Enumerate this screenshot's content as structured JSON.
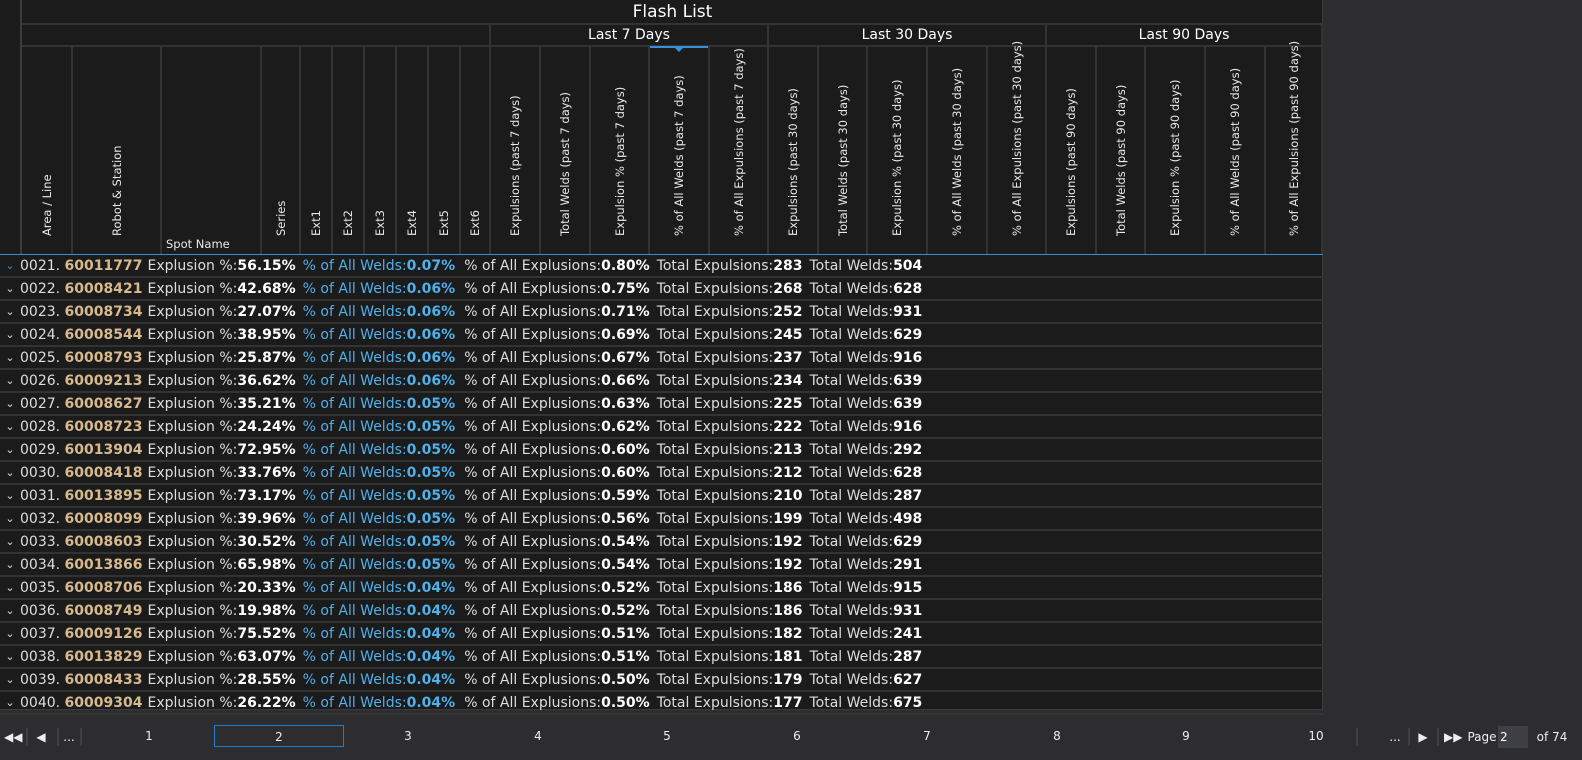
{
  "title": "Flash List",
  "groups": [
    "Last 7 Days",
    "Last 30 Days",
    "Last 90 Days"
  ],
  "columns": [
    "Area / Line",
    "Robot & Station",
    "Spot Name",
    "Series",
    "Ext1",
    "Ext2",
    "Ext3",
    "Ext4",
    "Ext5",
    "Ext6",
    "Expulsions (past 7 days)",
    "Total Welds (past 7 days)",
    "Expulsion % (past 7 days)",
    "% of All Welds (past 7 days)",
    "% of All Expulsions (past 7 days)",
    "Expulsions (past 30 days)",
    "Total Welds (past 30 days)",
    "Expulsion % (past 30 days)",
    "% of All Welds (past 30 days)",
    "% of All Expulsions (past 30 days)",
    "Expulsions (past 90 days)",
    "Total Welds (past 90 days)",
    "Expulsion % (past 90 days)",
    "% of All Welds (past 90 days)",
    "% of All Expulsions (past 90 days)"
  ],
  "labels": {
    "exp_pct": "Explusion %:",
    "pct_welds": "% of All Welds:",
    "pct_exp": "% of All Explusions:",
    "total_exp": "Total Expulsions:",
    "total_welds": "Total Welds:"
  },
  "rows": [
    {
      "n": "0021.",
      "id": "60011777",
      "exp": "56.15%",
      "welds_pct": "0.07%",
      "exps_pct": "0.80%",
      "total_exp": "283",
      "total_welds": "504"
    },
    {
      "n": "0022.",
      "id": "60008421",
      "exp": "42.68%",
      "welds_pct": "0.06%",
      "exps_pct": "0.75%",
      "total_exp": "268",
      "total_welds": "628"
    },
    {
      "n": "0023.",
      "id": "60008734",
      "exp": "27.07%",
      "welds_pct": "0.06%",
      "exps_pct": "0.71%",
      "total_exp": "252",
      "total_welds": "931"
    },
    {
      "n": "0024.",
      "id": "60008544",
      "exp": "38.95%",
      "welds_pct": "0.06%",
      "exps_pct": "0.69%",
      "total_exp": "245",
      "total_welds": "629"
    },
    {
      "n": "0025.",
      "id": "60008793",
      "exp": "25.87%",
      "welds_pct": "0.06%",
      "exps_pct": "0.67%",
      "total_exp": "237",
      "total_welds": "916"
    },
    {
      "n": "0026.",
      "id": "60009213",
      "exp": "36.62%",
      "welds_pct": "0.06%",
      "exps_pct": "0.66%",
      "total_exp": "234",
      "total_welds": "639"
    },
    {
      "n": "0027.",
      "id": "60008627",
      "exp": "35.21%",
      "welds_pct": "0.05%",
      "exps_pct": "0.63%",
      "total_exp": "225",
      "total_welds": "639"
    },
    {
      "n": "0028.",
      "id": "60008723",
      "exp": "24.24%",
      "welds_pct": "0.05%",
      "exps_pct": "0.62%",
      "total_exp": "222",
      "total_welds": "916"
    },
    {
      "n": "0029.",
      "id": "60013904",
      "exp": "72.95%",
      "welds_pct": "0.05%",
      "exps_pct": "0.60%",
      "total_exp": "213",
      "total_welds": "292"
    },
    {
      "n": "0030.",
      "id": "60008418",
      "exp": "33.76%",
      "welds_pct": "0.05%",
      "exps_pct": "0.60%",
      "total_exp": "212",
      "total_welds": "628"
    },
    {
      "n": "0031.",
      "id": "60013895",
      "exp": "73.17%",
      "welds_pct": "0.05%",
      "exps_pct": "0.59%",
      "total_exp": "210",
      "total_welds": "287"
    },
    {
      "n": "0032.",
      "id": "60008099",
      "exp": "39.96%",
      "welds_pct": "0.05%",
      "exps_pct": "0.56%",
      "total_exp": "199",
      "total_welds": "498"
    },
    {
      "n": "0033.",
      "id": "60008603",
      "exp": "30.52%",
      "welds_pct": "0.05%",
      "exps_pct": "0.54%",
      "total_exp": "192",
      "total_welds": "629"
    },
    {
      "n": "0034.",
      "id": "60013866",
      "exp": "65.98%",
      "welds_pct": "0.05%",
      "exps_pct": "0.54%",
      "total_exp": "192",
      "total_welds": "291"
    },
    {
      "n": "0035.",
      "id": "60008706",
      "exp": "20.33%",
      "welds_pct": "0.04%",
      "exps_pct": "0.52%",
      "total_exp": "186",
      "total_welds": "915"
    },
    {
      "n": "0036.",
      "id": "60008749",
      "exp": "19.98%",
      "welds_pct": "0.04%",
      "exps_pct": "0.52%",
      "total_exp": "186",
      "total_welds": "931"
    },
    {
      "n": "0037.",
      "id": "60009126",
      "exp": "75.52%",
      "welds_pct": "0.04%",
      "exps_pct": "0.51%",
      "total_exp": "182",
      "total_welds": "241"
    },
    {
      "n": "0038.",
      "id": "60013829",
      "exp": "63.07%",
      "welds_pct": "0.04%",
      "exps_pct": "0.51%",
      "total_exp": "181",
      "total_welds": "287"
    },
    {
      "n": "0039.",
      "id": "60008433",
      "exp": "28.55%",
      "welds_pct": "0.04%",
      "exps_pct": "0.50%",
      "total_exp": "179",
      "total_welds": "627"
    },
    {
      "n": "0040.",
      "id": "60009304",
      "exp": "26.22%",
      "welds_pct": "0.04%",
      "exps_pct": "0.50%",
      "total_exp": "177",
      "total_welds": "675"
    }
  ],
  "pager": {
    "ellipsis": "...",
    "pages": [
      "1",
      "2",
      "3",
      "4",
      "5",
      "6",
      "7",
      "8",
      "9",
      "10"
    ],
    "current": "2",
    "page_label": "Page",
    "of_label": "of 74"
  }
}
